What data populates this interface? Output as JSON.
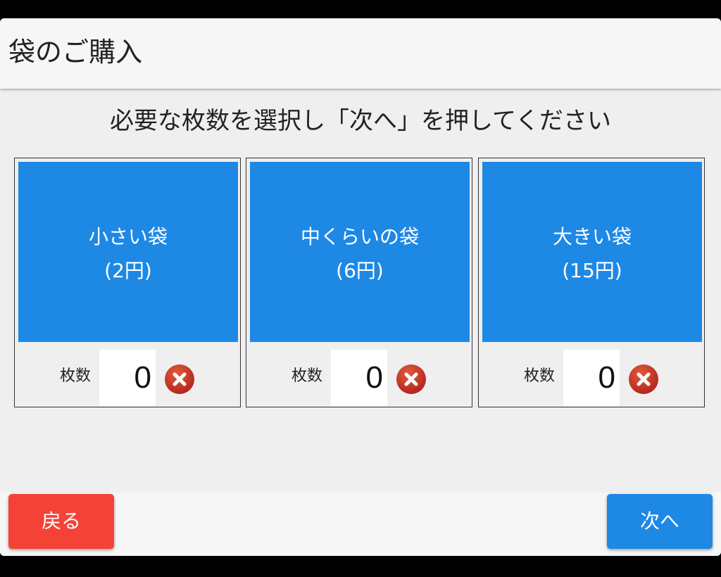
{
  "header": {
    "title": "袋のご購入"
  },
  "instruction": "必要な枚数を選択し「次へ」を押してください",
  "bags": [
    {
      "name": "小さい袋",
      "price": "(2円)",
      "qty_label": "枚数",
      "qty": "0"
    },
    {
      "name": "中くらいの袋",
      "price": "(6円)",
      "qty_label": "枚数",
      "qty": "0"
    },
    {
      "name": "大きい袋",
      "price": "(15円)",
      "qty_label": "枚数",
      "qty": "0"
    }
  ],
  "footer": {
    "back_label": "戻る",
    "next_label": "次へ"
  },
  "colors": {
    "accent_blue": "#1e88e5",
    "back_red": "#f44336",
    "clear_red": "#c62828",
    "background": "#efefef"
  },
  "icons": {
    "clear": "clear-x-icon"
  }
}
